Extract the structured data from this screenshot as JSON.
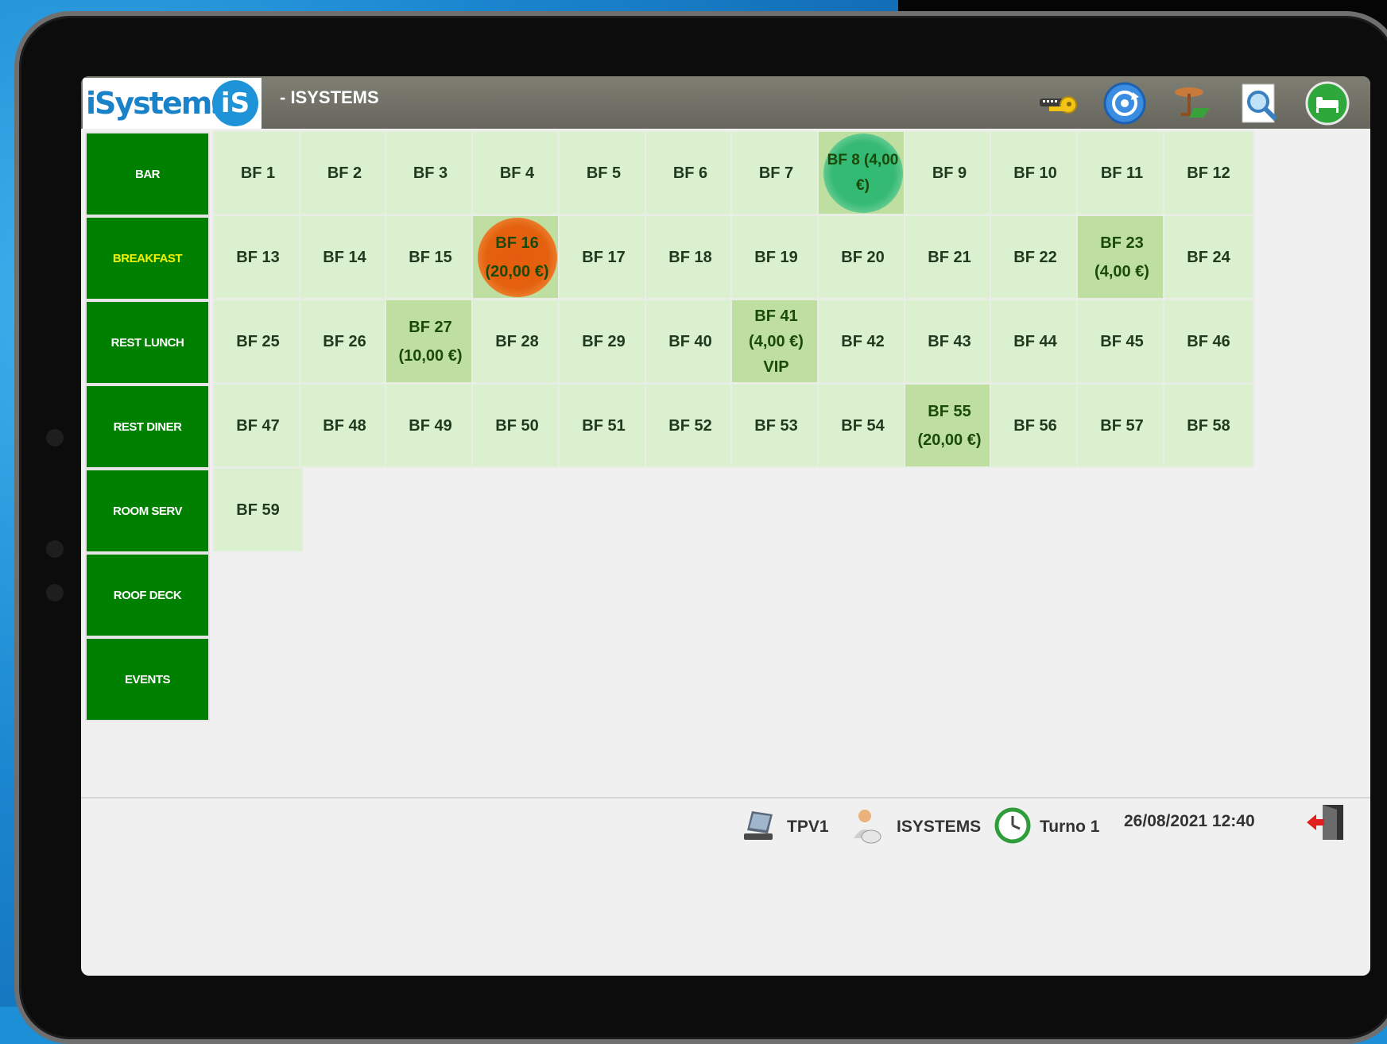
{
  "header": {
    "logo_text": "iSystems",
    "logo_badge": "iS",
    "title": "- ISYSTEMS",
    "icons": [
      "key-icon",
      "loop-icon",
      "table-icon",
      "search-icon",
      "bed-icon"
    ]
  },
  "sidebar": {
    "items": [
      {
        "label": "BAR"
      },
      {
        "label": "BREAKFAST"
      },
      {
        "label": "REST LUNCH"
      },
      {
        "label": "REST DINER"
      },
      {
        "label": "ROOM SERV"
      },
      {
        "label": "ROOF DECK"
      },
      {
        "label": "EVENTS"
      }
    ],
    "active_index": 1
  },
  "tables": {
    "rows": [
      [
        {
          "label": "BF 1"
        },
        {
          "label": "BF 2"
        },
        {
          "label": "BF 3"
        },
        {
          "label": "BF 4"
        },
        {
          "label": "BF 5"
        },
        {
          "label": "BF 6"
        },
        {
          "label": "BF 7"
        },
        {
          "label": "BF 8 (4,00\n€)",
          "status": "green"
        },
        {
          "label": "BF 9"
        },
        {
          "label": "BF 10"
        },
        {
          "label": "BF 11"
        },
        {
          "label": "BF 12"
        }
      ],
      [
        {
          "label": "BF 13"
        },
        {
          "label": "BF 14"
        },
        {
          "label": "BF 15"
        },
        {
          "label": "BF 16\n(20,00 €)",
          "status": "orange"
        },
        {
          "label": "BF 17"
        },
        {
          "label": "BF 18"
        },
        {
          "label": "BF 19"
        },
        {
          "label": "BF 20"
        },
        {
          "label": "BF 21"
        },
        {
          "label": "BF 22"
        },
        {
          "label": "BF 23\n(4,00 €)",
          "status": "busy"
        },
        {
          "label": "BF 24"
        }
      ],
      [
        {
          "label": "BF 25"
        },
        {
          "label": "BF 26"
        },
        {
          "label": "BF 27\n(10,00 €)",
          "status": "busy"
        },
        {
          "label": "BF 28"
        },
        {
          "label": "BF 29"
        },
        {
          "label": "BF 40"
        },
        {
          "label": "BF 41\n(4,00 €)\nVIP",
          "status": "busy"
        },
        {
          "label": "BF 42"
        },
        {
          "label": "BF 43"
        },
        {
          "label": "BF 44"
        },
        {
          "label": "BF 45"
        },
        {
          "label": "BF 46"
        }
      ],
      [
        {
          "label": "BF 47"
        },
        {
          "label": "BF 48"
        },
        {
          "label": "BF 49"
        },
        {
          "label": "BF 50"
        },
        {
          "label": "BF 51"
        },
        {
          "label": "BF 52"
        },
        {
          "label": "BF 53"
        },
        {
          "label": "BF 54"
        },
        {
          "label": "BF 55\n(20,00 €)",
          "status": "busy"
        },
        {
          "label": "BF 56"
        },
        {
          "label": "BF 57"
        },
        {
          "label": "BF 58"
        }
      ],
      [
        {
          "label": "BF 59"
        }
      ]
    ]
  },
  "footer": {
    "terminal": "TPV1",
    "user": "ISYSTEMS",
    "shift": "Turno 1",
    "datetime": "26/08/2021 12:40"
  },
  "colors": {
    "sidebar_bg": "#008000",
    "active_label": "#f2f200",
    "table_free": "#dbf0cf",
    "table_busy": "#bedf9f",
    "status_green": "#36b975",
    "status_orange": "#e4610f"
  }
}
